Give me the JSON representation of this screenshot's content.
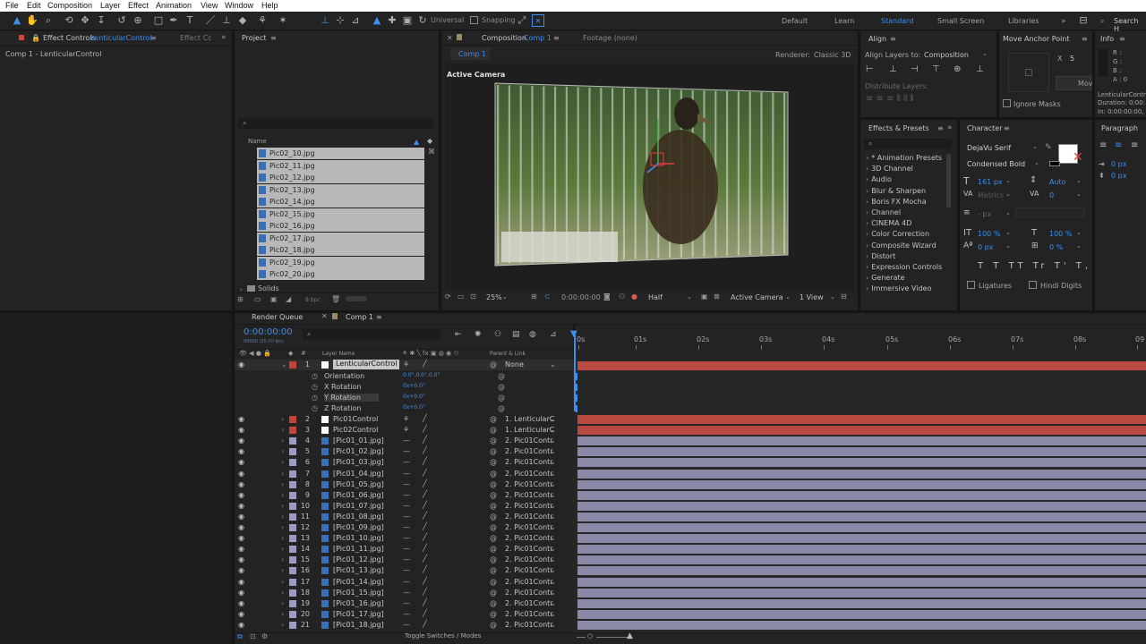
{
  "menu": [
    "File",
    "Edit",
    "Composition",
    "Layer",
    "Effect",
    "Animation",
    "View",
    "Window",
    "Help"
  ],
  "toolbar": {
    "universal": "Universal",
    "snapping": "Snapping"
  },
  "workspaces": {
    "items": [
      "Default",
      "Learn",
      "Standard",
      "Small Screen",
      "Libraries"
    ],
    "search": "Search H"
  },
  "effect_controls": {
    "tab": "Effect Controls",
    "tab_layer": "LenticularControl",
    "tab2": "Effect Cc",
    "path": "Comp 1 - LenticularControl"
  },
  "project": {
    "tab": "Project",
    "name_header": "Name",
    "files": [
      "Pic02_10.jpg",
      "Pic02_11.jpg",
      "Pic02_12.jpg",
      "Pic02_13.jpg",
      "Pic02_14.jpg",
      "Pic02_15.jpg",
      "Pic02_16.jpg",
      "Pic02_17.jpg",
      "Pic02_18.jpg",
      "Pic02_19.jpg",
      "Pic02_20.jpg"
    ],
    "solids": "Solids",
    "bpc": "8 bpc"
  },
  "composition": {
    "tab": "Composition",
    "tab_comp": "Comp 1",
    "footage": "Footage (none)",
    "subtab": "Comp 1",
    "renderer_label": "Renderer:",
    "renderer": "Classic 3D",
    "active_camera": "Active Camera",
    "zoom": "25%",
    "timecode": "0:00:00:00",
    "resolution": "Half",
    "camera": "Active Camera",
    "view": "1 View"
  },
  "align": {
    "tab": "Align",
    "align_to_label": "Align Layers to:",
    "align_to": "Composition",
    "distribute": "Distribute Layers:"
  },
  "anchor": {
    "tab": "Move Anchor Point",
    "x_label": "X",
    "x_value": "5",
    "button": "Mov",
    "ignore_masks": "Ignore Masks"
  },
  "info": {
    "tab": "Info",
    "r": "R :",
    "g": "G :",
    "b": "B :",
    "a": "A : 0",
    "layer": "LenticularContr",
    "duration": "Duration: 0:00:",
    "in": "In: 0:00:00:00, "
  },
  "effects_presets": {
    "tab": "Effects & Presets",
    "items": [
      "* Animation Presets",
      "3D Channel",
      "Audio",
      "Blur & Sharpen",
      "Boris FX Mocha",
      "Channel",
      "CINEMA 4D",
      "Color Correction",
      "Composite Wizard",
      "Distort",
      "Expression Controls",
      "Generate",
      "Immersive Video"
    ]
  },
  "character": {
    "tab": "Character",
    "font": "DejaVu Serif",
    "style": "Condensed Bold",
    "size": "161 px",
    "leading": "Auto",
    "kerning": "Metrics",
    "tracking": "0",
    "stroke_unit": "- px",
    "vscale": "100 %",
    "hscale": "100 %",
    "baseline": "0 px",
    "tsume": "0 %",
    "ligatures": "Ligatures",
    "hindi_digits": "Hindi Digits"
  },
  "paragraph": {
    "tab": "Paragraph",
    "v1": "0 px",
    "v2": "0 px"
  },
  "timeline": {
    "tab_render": "Render Queue",
    "tab_comp": "Comp 1",
    "timecode": "0:00:00:00",
    "fps": "00000 (25.00 fps)",
    "layer_name_header": "Layer Name",
    "parent_header": "Parent & Link",
    "toggle": "Toggle Switches / Modes",
    "ticks": [
      "0s",
      "01s",
      "02s",
      "03s",
      "04s",
      "05s",
      "06s",
      "07s",
      "08s",
      "09"
    ],
    "layer1": {
      "num": "1",
      "name": "LenticularControl",
      "parent": "None"
    },
    "props": [
      {
        "name": "Orientation",
        "value": "0.0°,0.0°,0.0°"
      },
      {
        "name": "X Rotation",
        "value": "0x+0.0°"
      },
      {
        "name": "Y Rotation",
        "value": "0x+0.0°"
      },
      {
        "name": "Z Rotation",
        "value": "0x+0.0°"
      }
    ],
    "layers": [
      {
        "num": "2",
        "name": "Pic01Control",
        "parent": "1. LenticularC",
        "color": "#c0453c",
        "solid": true
      },
      {
        "num": "3",
        "name": "Pic02Control",
        "parent": "1. LenticularC",
        "color": "#c0453c",
        "solid": true
      },
      {
        "num": "4",
        "name": "[Pic01_01.jpg]",
        "parent": "2. Pic01Contr",
        "color": "#9d9dc4",
        "solid": false
      },
      {
        "num": "5",
        "name": "[Pic01_02.jpg]",
        "parent": "2. Pic01Contr",
        "color": "#9d9dc4",
        "solid": false
      },
      {
        "num": "6",
        "name": "[Pic01_03.jpg]",
        "parent": "2. Pic01Contr",
        "color": "#9d9dc4",
        "solid": false
      },
      {
        "num": "7",
        "name": "[Pic01_04.jpg]",
        "parent": "2. Pic01Contr",
        "color": "#9d9dc4",
        "solid": false
      },
      {
        "num": "8",
        "name": "[Pic01_05.jpg]",
        "parent": "2. Pic01Contr",
        "color": "#9d9dc4",
        "solid": false
      },
      {
        "num": "9",
        "name": "[Pic01_06.jpg]",
        "parent": "2. Pic01Contr",
        "color": "#9d9dc4",
        "solid": false
      },
      {
        "num": "10",
        "name": "[Pic01_07.jpg]",
        "parent": "2. Pic01Contr",
        "color": "#9d9dc4",
        "solid": false
      },
      {
        "num": "11",
        "name": "[Pic01_08.jpg]",
        "parent": "2. Pic01Contr",
        "color": "#9d9dc4",
        "solid": false
      },
      {
        "num": "12",
        "name": "[Pic01_09.jpg]",
        "parent": "2. Pic01Contr",
        "color": "#9d9dc4",
        "solid": false
      },
      {
        "num": "13",
        "name": "[Pic01_10.jpg]",
        "parent": "2. Pic01Contr",
        "color": "#9d9dc4",
        "solid": false
      },
      {
        "num": "14",
        "name": "[Pic01_11.jpg]",
        "parent": "2. Pic01Contr",
        "color": "#9d9dc4",
        "solid": false
      },
      {
        "num": "15",
        "name": "[Pic01_12.jpg]",
        "parent": "2. Pic01Contr",
        "color": "#9d9dc4",
        "solid": false
      },
      {
        "num": "16",
        "name": "[Pic01_13.jpg]",
        "parent": "2. Pic01Contr",
        "color": "#9d9dc4",
        "solid": false
      },
      {
        "num": "17",
        "name": "[Pic01_14.jpg]",
        "parent": "2. Pic01Contr",
        "color": "#9d9dc4",
        "solid": false
      },
      {
        "num": "18",
        "name": "[Pic01_15.jpg]",
        "parent": "2. Pic01Contr",
        "color": "#9d9dc4",
        "solid": false
      },
      {
        "num": "19",
        "name": "[Pic01_16.jpg]",
        "parent": "2. Pic01Contr",
        "color": "#9d9dc4",
        "solid": false
      },
      {
        "num": "20",
        "name": "[Pic01_17.jpg]",
        "parent": "2. Pic01Contr",
        "color": "#9d9dc4",
        "solid": false
      },
      {
        "num": "21",
        "name": "[Pic01_18.jpg]",
        "parent": "2. Pic01Contr",
        "color": "#9d9dc4",
        "solid": false
      }
    ]
  }
}
